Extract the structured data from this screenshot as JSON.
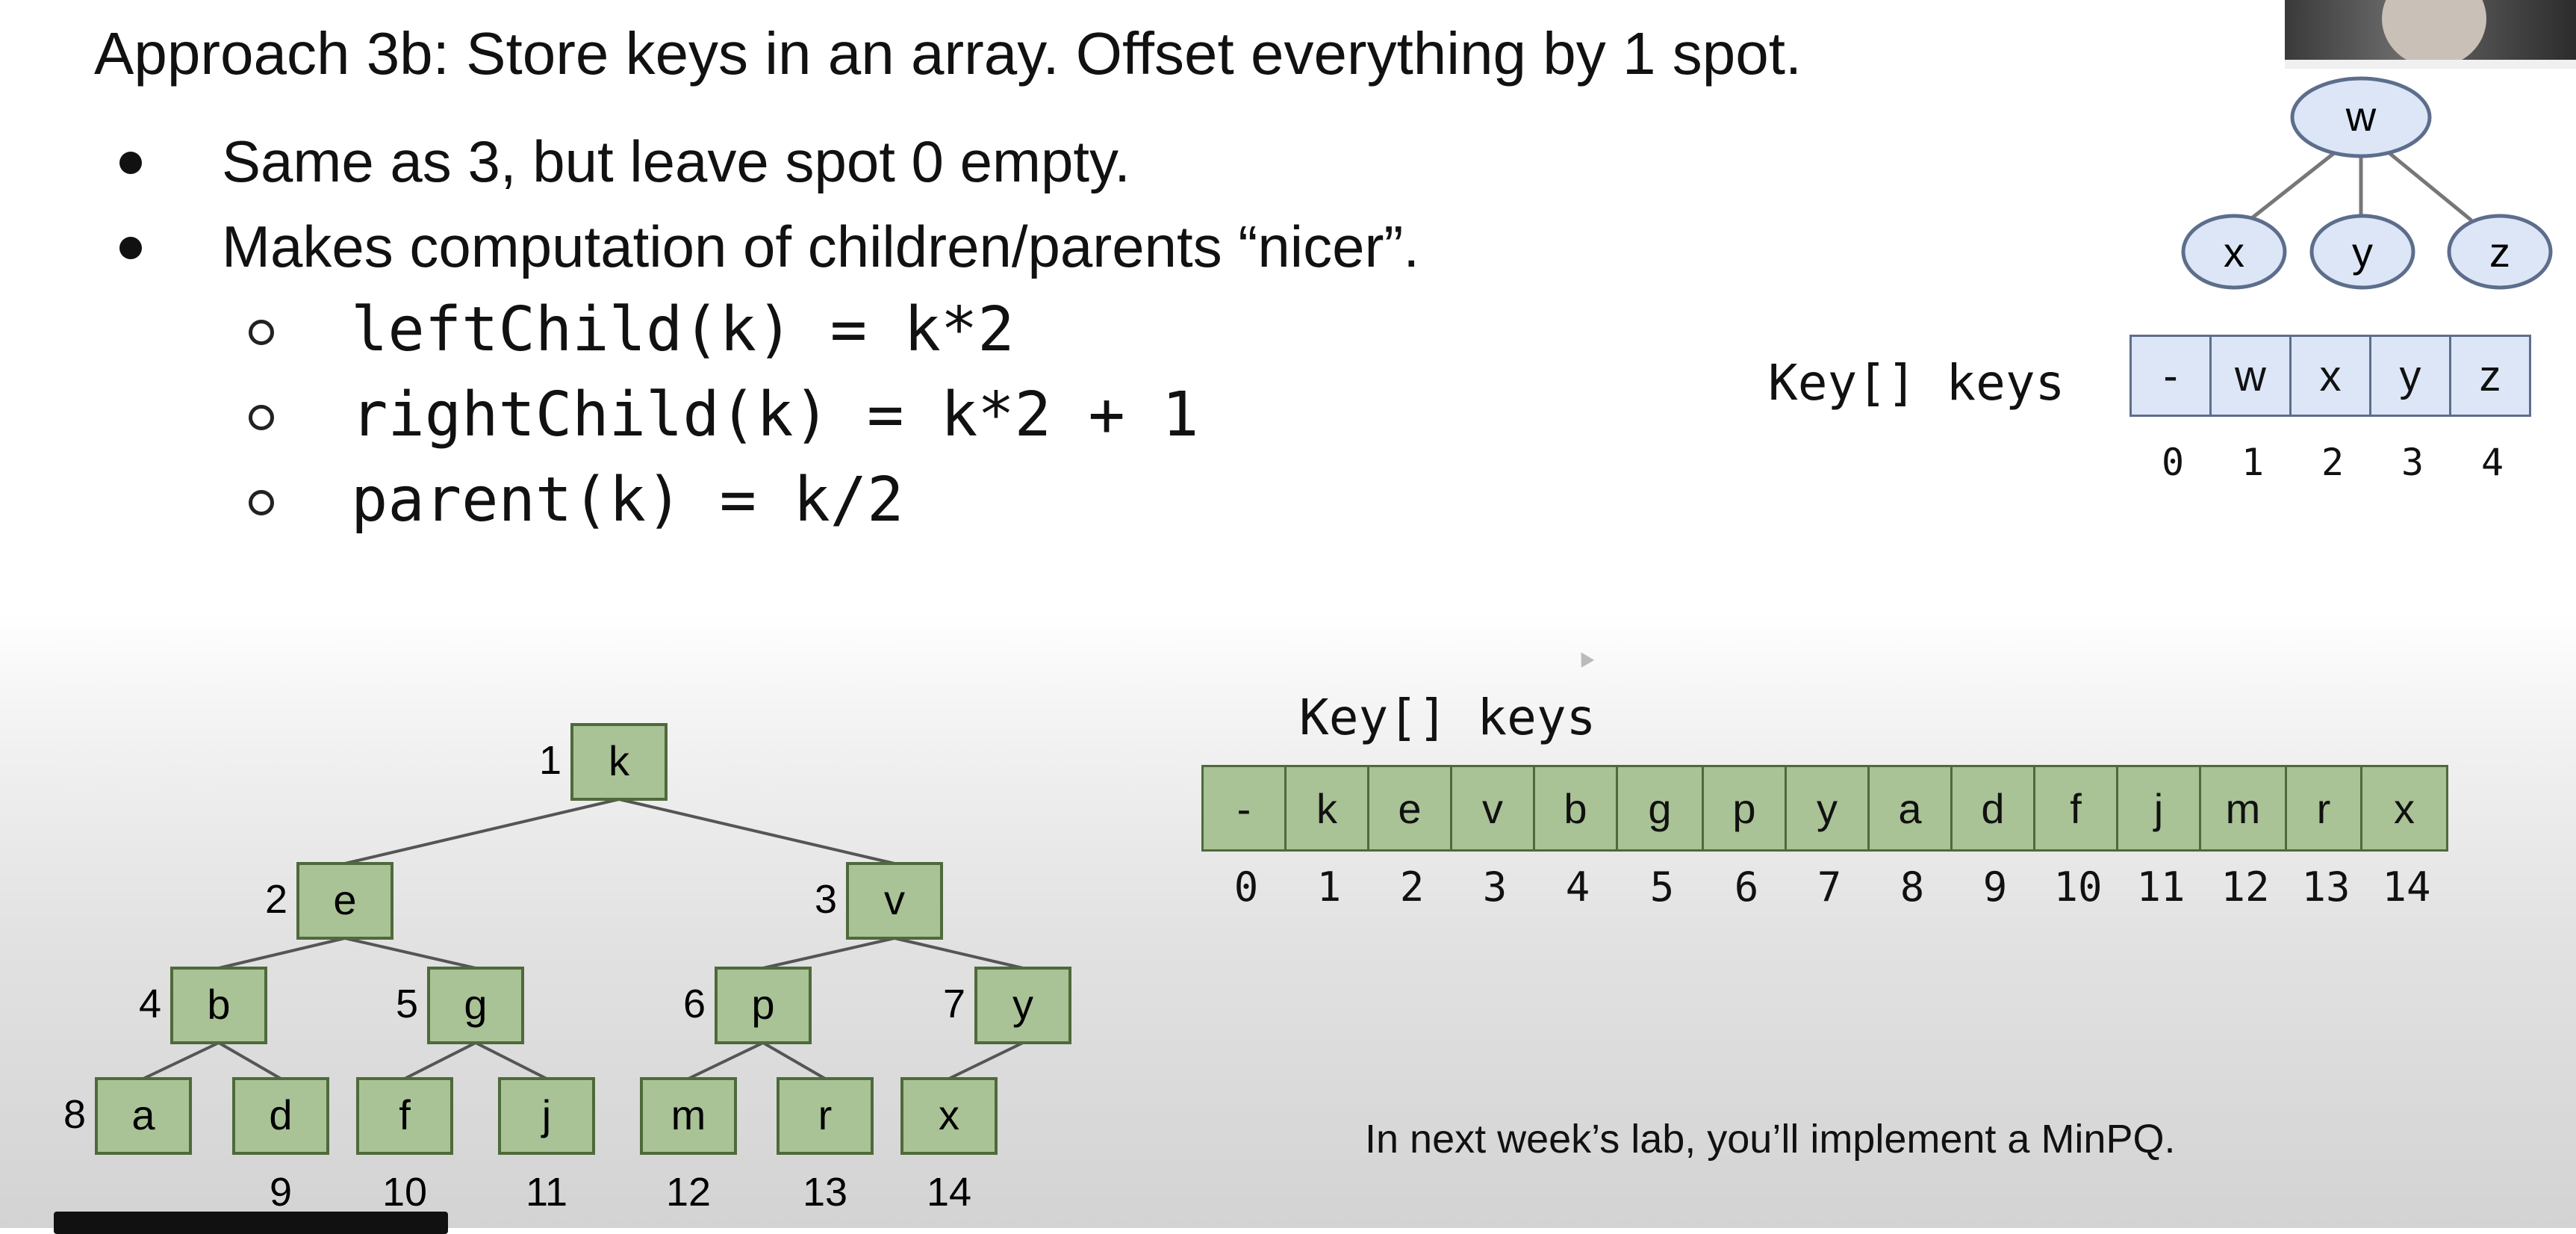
{
  "slide": {
    "title": "Approach 3b: Store keys in an array. Offset everything by 1 spot.",
    "bullets": [
      "Same as 3, but leave spot 0 empty.",
      "Makes computation of children/parents “nicer”."
    ],
    "formulas": [
      "leftChild(k) = k*2",
      "rightChild(k) = k*2 + 1",
      "parent(k) = k/2"
    ]
  },
  "small_example": {
    "array_label": "Key[] keys",
    "tree_nodes": [
      "w",
      "x",
      "y",
      "z"
    ],
    "cells": [
      "-",
      "w",
      "x",
      "y",
      "z"
    ],
    "indices": [
      "0",
      "1",
      "2",
      "3",
      "4"
    ],
    "colors": {
      "fill": "#dce6f6",
      "stroke": "#5d6d8c"
    }
  },
  "big_example": {
    "array_label": "Key[] keys",
    "tree_nodes": [
      {
        "idx": "1",
        "key": "k"
      },
      {
        "idx": "2",
        "key": "e"
      },
      {
        "idx": "3",
        "key": "v"
      },
      {
        "idx": "4",
        "key": "b"
      },
      {
        "idx": "5",
        "key": "g"
      },
      {
        "idx": "6",
        "key": "p"
      },
      {
        "idx": "7",
        "key": "y"
      },
      {
        "idx": "8",
        "key": "a"
      },
      {
        "idx": "9",
        "key": "d"
      },
      {
        "idx": "10",
        "key": "f"
      },
      {
        "idx": "11",
        "key": "j"
      },
      {
        "idx": "12",
        "key": "m"
      },
      {
        "idx": "13",
        "key": "r"
      },
      {
        "idx": "14",
        "key": "x"
      }
    ],
    "cells": [
      "-",
      "k",
      "e",
      "v",
      "b",
      "g",
      "p",
      "y",
      "a",
      "d",
      "f",
      "j",
      "m",
      "r",
      "x"
    ],
    "indices": [
      "0",
      "1",
      "2",
      "3",
      "4",
      "5",
      "6",
      "7",
      "8",
      "9",
      "10",
      "11",
      "12",
      "13",
      "14"
    ],
    "colors": {
      "fill": "#a9c296",
      "stroke": "#4e6a3a"
    }
  },
  "note": "In next week’s lab, you’ll implement a MinPQ."
}
